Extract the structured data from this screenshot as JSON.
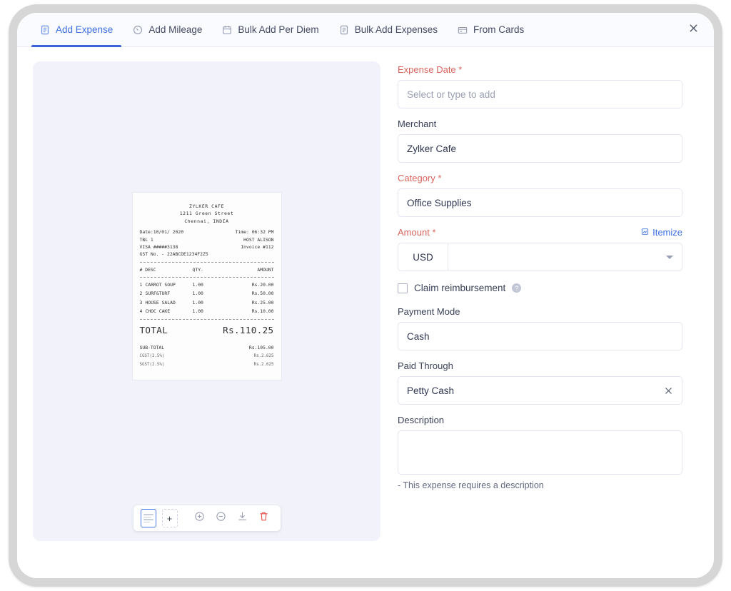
{
  "window": {
    "close_label": "×"
  },
  "tabs": [
    {
      "label": "Add Expense",
      "icon": "receipt-icon",
      "active": true
    },
    {
      "label": "Add Mileage",
      "icon": "gauge-icon",
      "active": false
    },
    {
      "label": "Bulk Add Per Diem",
      "icon": "calendar-icon",
      "active": false
    },
    {
      "label": "Bulk Add Expenses",
      "icon": "receipt-stack-icon",
      "active": false
    },
    {
      "label": "From Cards",
      "icon": "credit-card-icon",
      "active": false
    }
  ],
  "receipt": {
    "merchant": "ZYLKER CAFE",
    "address_line1": "1211 Green Street",
    "address_line2": "Chennai, INDIA",
    "date_label": "Date:10/01/ 2020",
    "time_label": "Time: 06:32 PM",
    "table_label": "TBL 1",
    "host_label": "HOST ALISON",
    "card_label": "VISA #####3138",
    "invoice_label": "Invoice #112",
    "gst_label": "GST No. - 22ABCDE1234F2Z5",
    "columns": {
      "num": "#",
      "desc": "DESC",
      "qty": "QTY.",
      "amount": "AMOUNT"
    },
    "items": [
      {
        "num": "1",
        "desc": "CARROT SOUP",
        "qty": "1.00",
        "amount": "Rs.20.00"
      },
      {
        "num": "2",
        "desc": "SURF&TURF",
        "qty": "1.00",
        "amount": "Rs.50.00"
      },
      {
        "num": "3",
        "desc": "HOUSE SALAD",
        "qty": "1.00",
        "amount": "Rs.25.00"
      },
      {
        "num": "4",
        "desc": "CHOC CAKE",
        "qty": "1.00",
        "amount": "Rs.10.00"
      }
    ],
    "total_label": "TOTAL",
    "total_value": "Rs.110.25",
    "subtotal_label": "SUB-TOTAL",
    "subtotal_value": "Rs.105.00",
    "cgst_label": "CGST(2.5%)",
    "cgst_value": "Rs.2.625",
    "sgst_label": "SGST(2.5%)",
    "sgst_value": "Rs.2.625"
  },
  "image_toolbar": {
    "thumbnail_name": "receipt-thumbnail",
    "add_page_label": "+",
    "zoom_in_name": "zoom-in-icon",
    "zoom_out_name": "zoom-out-icon",
    "download_name": "download-icon",
    "delete_name": "delete-icon"
  },
  "form": {
    "expense_date": {
      "label": "Expense Date",
      "required_mark": "*",
      "value": "",
      "placeholder": "Select or type to add"
    },
    "merchant": {
      "label": "Merchant",
      "value": "Zylker Cafe"
    },
    "category": {
      "label": "Category",
      "required_mark": "*",
      "value": "Office Supplies"
    },
    "amount": {
      "label": "Amount",
      "required_mark": "*",
      "itemize_label": "Itemize",
      "currency": "USD",
      "value": ""
    },
    "claim_reimbursement": {
      "label": "Claim reimbursement",
      "checked": false
    },
    "payment_mode": {
      "label": "Payment Mode",
      "value": "Cash"
    },
    "paid_through": {
      "label": "Paid Through",
      "value": "Petty Cash"
    },
    "description": {
      "label": "Description",
      "value": "",
      "hint": "- This expense requires a description"
    }
  },
  "colors": {
    "accent": "#3a63d8",
    "required": "#d9645e",
    "link": "#3d6ee0",
    "danger": "#e8504a",
    "viewer_bg": "#f2f3fa"
  }
}
